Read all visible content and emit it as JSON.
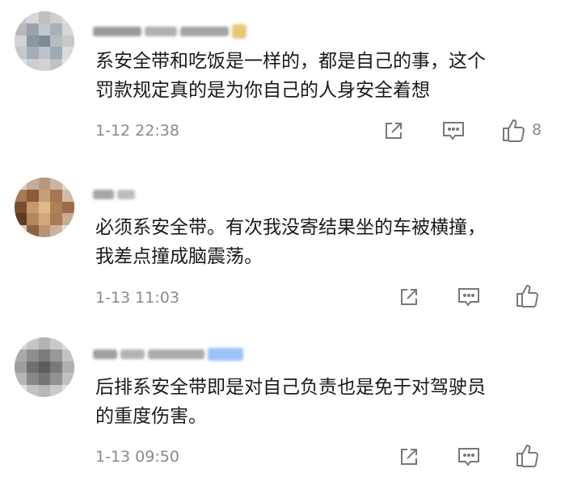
{
  "comments": [
    {
      "text_line1": "系安全带和吃饭是一样的，都是自己的事，这个",
      "text_line2": "罚款规定真的是为你自己的人身安全着想",
      "timestamp": "1-12 22:38",
      "like_count": "8"
    },
    {
      "text_line1": "必须系安全带。有次我没寄结果坐的车被横撞，",
      "text_line2": "我差点撞成脑震荡。",
      "timestamp": "1-13 11:03",
      "like_count": ""
    },
    {
      "text_line1": "后排系安全带即是对自己负责也是免于对驾驶员",
      "text_line2": "的重度伤害。",
      "timestamp": "1-13 09:50",
      "like_count": ""
    }
  ],
  "icons": {
    "share": "share-icon",
    "comment": "comment-icon",
    "like": "thumbs-up-icon"
  },
  "colors": {
    "text": "#1a1a1a",
    "meta": "#8a8a8a",
    "icon": "#777777",
    "badge": "#9cc3f5"
  }
}
